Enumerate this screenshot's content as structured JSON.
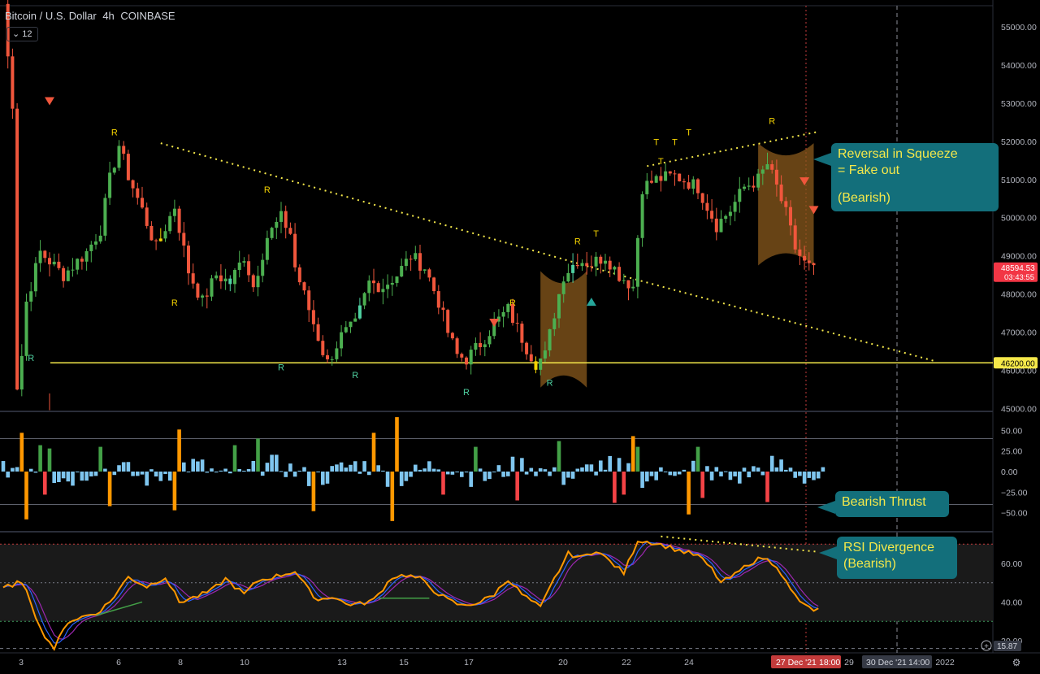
{
  "header": {
    "symbol": "Bitcoin / U.S. Dollar",
    "interval": "4h",
    "exchange": "COINBASE",
    "indicator_count": "12"
  },
  "price_labels": {
    "current_price": "48594.53",
    "countdown": "03:43:55",
    "support_level": "46200.00"
  },
  "callouts": {
    "squeeze_line1": "Reversal in Squeeze",
    "squeeze_line2": "= Fake out",
    "squeeze_line3": "(Bearish)",
    "thrust": "Bearish Thrust",
    "rsi_line1": "RSI Divergence",
    "rsi_line2": "(Bearish)"
  },
  "time_labels": {
    "crosshair_date": "27 Dec '21",
    "crosshair_time": "18:00",
    "after_crosshair": "29",
    "future_date": "30 Dec '21",
    "future_time": "14:00",
    "year": "2022"
  },
  "colors": {
    "bull": "#4caf50",
    "bear": "#f0563c",
    "support": "#f5e84a",
    "trend": "#f5e84a",
    "squeeze": "#8a5a1c",
    "hist_blue": "#7fc6ef",
    "hist_orange": "#ff9800",
    "hist_green": "#43a047",
    "hist_red": "#f44346",
    "rsi": "#ff9800",
    "ma1": "#2962ff",
    "ma2": "#9c27b0"
  },
  "chart_data": [
    {
      "type": "candlestick",
      "x_ticks": [
        "3",
        "6",
        "8",
        "10",
        "13",
        "15",
        "17",
        "20",
        "22",
        "24"
      ],
      "y_ticks": [
        "55000.00",
        "54000.00",
        "53000.00",
        "52000.00",
        "51000.00",
        "50000.00",
        "49000.00",
        "48000.00",
        "47000.00",
        "46000.00",
        "45000.00"
      ],
      "ylim": [
        44950,
        55550
      ],
      "support_level": 46200,
      "current_price": 48594.53,
      "close_path": [
        [
          0,
          55600
        ],
        [
          1,
          54200
        ],
        [
          2,
          53000
        ],
        [
          3,
          45600
        ],
        [
          4,
          46400
        ],
        [
          5,
          47800
        ],
        [
          8,
          49100
        ],
        [
          13,
          48500
        ],
        [
          18,
          49100
        ],
        [
          21,
          49700
        ],
        [
          23,
          51000
        ],
        [
          25,
          51900
        ],
        [
          27,
          51100
        ],
        [
          30,
          50200
        ],
        [
          33,
          49200
        ],
        [
          37,
          50300
        ],
        [
          40,
          48600
        ],
        [
          43,
          47800
        ],
        [
          46,
          48500
        ],
        [
          49,
          48300
        ],
        [
          52,
          49000
        ],
        [
          54,
          48200
        ],
        [
          57,
          49500
        ],
        [
          60,
          50000
        ],
        [
          62,
          49600
        ],
        [
          63,
          48700
        ],
        [
          66,
          47600
        ],
        [
          69,
          46500
        ],
        [
          70,
          46200
        ],
        [
          73,
          46900
        ],
        [
          76,
          47200
        ],
        [
          79,
          48300
        ],
        [
          82,
          48200
        ],
        [
          85,
          48500
        ],
        [
          88,
          49000
        ],
        [
          91,
          48700
        ],
        [
          94,
          47800
        ],
        [
          96,
          47000
        ],
        [
          98,
          46400
        ],
        [
          100,
          46300
        ],
        [
          103,
          46700
        ],
        [
          106,
          47200
        ],
        [
          109,
          47600
        ],
        [
          111,
          47100
        ],
        [
          113,
          46600
        ],
        [
          115,
          46200
        ],
        [
          117,
          46400
        ],
        [
          119,
          47500
        ],
        [
          121,
          48500
        ],
        [
          124,
          48900
        ],
        [
          127,
          48800
        ],
        [
          130,
          49000
        ],
        [
          133,
          48500
        ],
        [
          136,
          48200
        ],
        [
          138,
          50800
        ],
        [
          141,
          51000
        ],
        [
          145,
          51100
        ],
        [
          150,
          50800
        ],
        [
          152,
          50300
        ],
        [
          154,
          49800
        ],
        [
          157,
          50200
        ],
        [
          160,
          50800
        ],
        [
          163,
          51000
        ],
        [
          165,
          51400
        ],
        [
          167,
          50800
        ],
        [
          169,
          50100
        ],
        [
          171,
          49200
        ],
        [
          173,
          48800
        ],
        [
          175,
          48600
        ]
      ],
      "pattern_labels": [
        {
          "text": "R",
          "i": 6,
          "price": 46250
        },
        {
          "text": "R",
          "i": 24,
          "price": 52150
        },
        {
          "text": "R",
          "i": 37,
          "price": 47700
        },
        {
          "text": "R",
          "i": 57,
          "price": 50650
        },
        {
          "text": "R",
          "i": 60,
          "price": 46000
        },
        {
          "text": "R",
          "i": 76,
          "price": 45800
        },
        {
          "text": "R",
          "i": 100,
          "price": 45350
        },
        {
          "text": "R",
          "i": 110,
          "price": 47700
        },
        {
          "text": "R",
          "i": 118,
          "price": 45600
        },
        {
          "text": "R",
          "i": 124,
          "price": 49300
        },
        {
          "text": "T",
          "i": 128,
          "price": 49500
        },
        {
          "text": "T",
          "i": 141,
          "price": 51900
        },
        {
          "text": "T",
          "i": 145,
          "price": 51900
        },
        {
          "text": "T",
          "i": 148,
          "price": 52150
        },
        {
          "text": "T",
          "i": 142,
          "price": 51400
        },
        {
          "text": "R",
          "i": 166,
          "price": 52450
        }
      ]
    },
    {
      "type": "bar",
      "name": "momentum histogram",
      "y_ticks": [
        "50.00",
        "25.00",
        "0.00",
        "−25.00",
        "−50.00"
      ],
      "ylim": [
        -72,
        72
      ],
      "big_bars": [
        {
          "i": 4,
          "v": 47,
          "c": "orange"
        },
        {
          "i": 5,
          "v": -58,
          "c": "orange"
        },
        {
          "i": 8,
          "v": 32,
          "c": "green"
        },
        {
          "i": 9,
          "v": -28,
          "c": "red"
        },
        {
          "i": 10,
          "v": 28,
          "c": "green"
        },
        {
          "i": 21,
          "v": 30,
          "c": "green"
        },
        {
          "i": 23,
          "v": -42,
          "c": "orange"
        },
        {
          "i": 38,
          "v": 51,
          "c": "orange"
        },
        {
          "i": 37,
          "v": -47,
          "c": "orange"
        },
        {
          "i": 50,
          "v": 32,
          "c": "green"
        },
        {
          "i": 55,
          "v": 40,
          "c": "green"
        },
        {
          "i": 67,
          "v": -48,
          "c": "orange"
        },
        {
          "i": 80,
          "v": 47,
          "c": "orange"
        },
        {
          "i": 85,
          "v": 66,
          "c": "orange"
        },
        {
          "i": 84,
          "v": -60,
          "c": "orange"
        },
        {
          "i": 95,
          "v": -28,
          "c": "red"
        },
        {
          "i": 102,
          "v": 30,
          "c": "green"
        },
        {
          "i": 111,
          "v": -35,
          "c": "red"
        },
        {
          "i": 120,
          "v": 37,
          "c": "green"
        },
        {
          "i": 132,
          "v": -38,
          "c": "red"
        },
        {
          "i": 136,
          "v": 43,
          "c": "orange"
        },
        {
          "i": 134,
          "v": -28,
          "c": "red"
        },
        {
          "i": 137,
          "v": 30,
          "c": "green"
        },
        {
          "i": 148,
          "v": -52,
          "c": "orange"
        },
        {
          "i": 150,
          "v": 30,
          "c": "green"
        },
        {
          "i": 151,
          "v": -32,
          "c": "red"
        },
        {
          "i": 165,
          "v": -37,
          "c": "red"
        }
      ]
    },
    {
      "type": "line",
      "name": "RSI",
      "y_ticks": [
        "60.00",
        "40.00",
        "20.00"
      ],
      "ylim": [
        14.5,
        76
      ],
      "bands": [
        70,
        50,
        30
      ],
      "min_label": "15.87",
      "rsi_path": [
        [
          0,
          47
        ],
        [
          3,
          50
        ],
        [
          5,
          47
        ],
        [
          8,
          26
        ],
        [
          11,
          16
        ],
        [
          14,
          30
        ],
        [
          18,
          33
        ],
        [
          20,
          34
        ],
        [
          23,
          40
        ],
        [
          27,
          53
        ],
        [
          31,
          48
        ],
        [
          35,
          53
        ],
        [
          38,
          40
        ],
        [
          42,
          43
        ],
        [
          45,
          46
        ],
        [
          48,
          52
        ],
        [
          52,
          44
        ],
        [
          55,
          51
        ],
        [
          60,
          54
        ],
        [
          63,
          56
        ],
        [
          66,
          46
        ],
        [
          68,
          41
        ],
        [
          71,
          43
        ],
        [
          74,
          39
        ],
        [
          77,
          39
        ],
        [
          80,
          41
        ],
        [
          84,
          53
        ],
        [
          87,
          54
        ],
        [
          90,
          52
        ],
        [
          93,
          46
        ],
        [
          96,
          41
        ],
        [
          99,
          38
        ],
        [
          103,
          40
        ],
        [
          106,
          44
        ],
        [
          109,
          52
        ],
        [
          112,
          44
        ],
        [
          116,
          37
        ],
        [
          119,
          52
        ],
        [
          122,
          65
        ],
        [
          125,
          63
        ],
        [
          128,
          67
        ],
        [
          131,
          61
        ],
        [
          134,
          55
        ],
        [
          137,
          72
        ],
        [
          140,
          71
        ],
        [
          143,
          69
        ],
        [
          147,
          66
        ],
        [
          150,
          64
        ],
        [
          153,
          57
        ],
        [
          155,
          50
        ],
        [
          158,
          54
        ],
        [
          161,
          60
        ],
        [
          164,
          63
        ],
        [
          167,
          59
        ],
        [
          170,
          46
        ],
        [
          173,
          38
        ],
        [
          175,
          36
        ]
      ]
    }
  ]
}
